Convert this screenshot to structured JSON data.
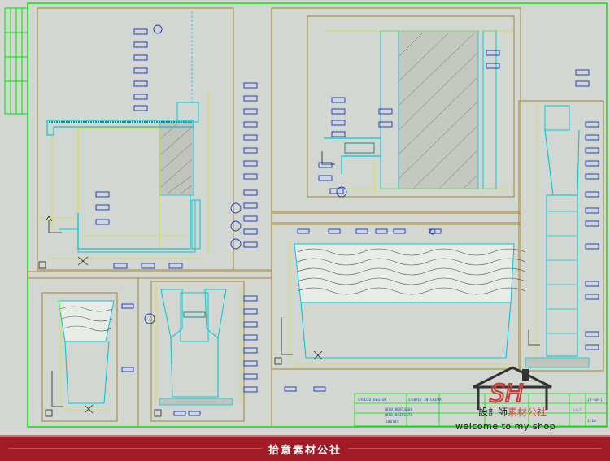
{
  "footer": {
    "label": "拾意素材公社"
  },
  "watermark": {
    "letters": "SH",
    "cn_prefix": "設計師",
    "cn_highlight": "素材公社",
    "en": "welcome to my shop"
  },
  "title_block": {
    "company": "STUDIO DESIGN",
    "project": "STUDIO INTERIOR",
    "phone1": "(010)86854660",
    "phone2": "(010)84256370",
    "date": "200707",
    "drawn": "D.S.T",
    "sheet_no": "JD-SD-1",
    "scale": "1:10"
  },
  "colors": {
    "frame_green": "#00e000",
    "tan": "#a58a3c",
    "cyan": "#00c8d8",
    "blue": "#1630c8",
    "yellow": "#e0e000",
    "black": "#222222",
    "footer_red": "#a01b26"
  }
}
